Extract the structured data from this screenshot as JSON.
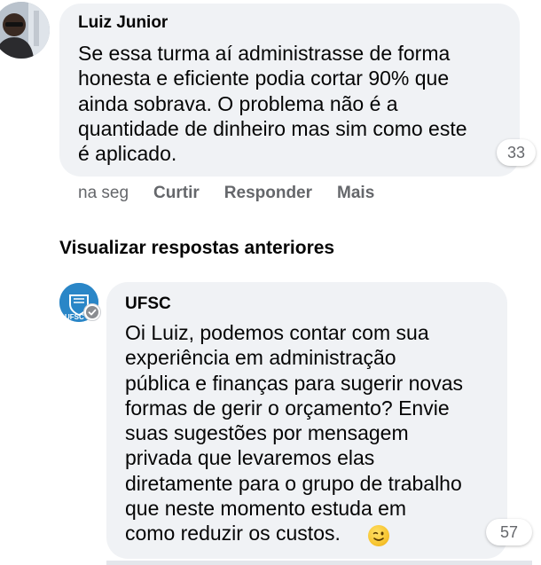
{
  "comments": [
    {
      "author": "Luiz Junior",
      "text": "Se essa turma aí administrasse de forma\nhonesta e eficiente podia cortar 90% que\nainda sobrava. O problema não é a\nquantidade de dinheiro mas sim como este\né aplicado.",
      "reaction_count": "33",
      "time": "na seg",
      "actions": [
        "Curtir",
        "Responder",
        "Mais"
      ]
    }
  ],
  "view_previous_replies": "Visualizar respostas anteriores",
  "reply": {
    "author": "UFSC",
    "avatar_text": "UFSC",
    "text": "Oi Luiz, podemos contar com sua\nexperiência em administração\npública e finanças para sugerir novas\nformas de gerir o orçamento? Envie\nsuas sugestões por mensagem\nprivada que levaremos elas\ndiretamente para o grupo de trabalho\nque neste momento estuda em\ncomo reduzir os custos.",
    "emoji": "winking-face",
    "reaction_count": "57"
  },
  "colors": {
    "bubble": "#f0f2f5",
    "secondary_text": "#65676b",
    "ufsc_blue": "#2a86c7"
  }
}
